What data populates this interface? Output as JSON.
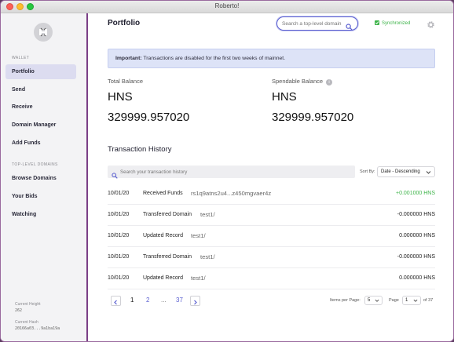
{
  "window": {
    "title": "Roberto!"
  },
  "sidebar": {
    "wallet_section": "WALLET",
    "wallet_items": [
      {
        "label": "Portfolio",
        "active": true
      },
      {
        "label": "Send"
      },
      {
        "label": "Receive"
      },
      {
        "label": "Domain Manager"
      },
      {
        "label": "Add Funds"
      }
    ],
    "domains_section": "TOP-LEVEL DOMAINS",
    "domain_items": [
      {
        "label": "Browse Domains"
      },
      {
        "label": "Your Bids"
      },
      {
        "label": "Watching"
      }
    ],
    "current_height_label": "Current Height",
    "current_height": "262",
    "current_hash_label": "Current Hash",
    "current_hash": "20166a03...9a1ba19a"
  },
  "header": {
    "title": "Portfolio",
    "search_placeholder": "Search a top-level domain",
    "sync_status": "Synchronized"
  },
  "notice": {
    "bold": "Important:",
    "text": " Transactions are disabled for the first two weeks of mainnet."
  },
  "balances": {
    "total_label": "Total Balance",
    "total_unit": "HNS",
    "total_value": "329999.957020",
    "spendable_label": "Spendable Balance",
    "spendable_unit": "HNS",
    "spendable_value": "329999.957020"
  },
  "transactions": {
    "heading": "Transaction History",
    "search_placeholder": "Search your transaction history",
    "sort_label": "Sort By:",
    "sort_value": "Date - Descending",
    "rows": [
      {
        "date": "10/01/20",
        "type": "Received Funds",
        "detail": "rs1q9atns2u4...z450mgvaer4z",
        "amount": "+0.001000 HNS",
        "positive": true
      },
      {
        "date": "10/01/20",
        "type": "Transferred Domain",
        "detail": "test1/",
        "amount": "-0.000000 HNS",
        "positive": false
      },
      {
        "date": "10/01/20",
        "type": "Updated Record",
        "detail": "test1/",
        "amount": "0.000000 HNS",
        "positive": false
      },
      {
        "date": "10/01/20",
        "type": "Transferred Domain",
        "detail": "test1/",
        "amount": "-0.000000 HNS",
        "positive": false
      },
      {
        "date": "10/01/20",
        "type": "Updated Record",
        "detail": "test1/",
        "amount": "0.000000 HNS",
        "positive": false
      }
    ]
  },
  "pagination": {
    "current": "1",
    "next": "2",
    "ellipsis": "...",
    "last": "37",
    "items_per_page_label": "Items per Page:",
    "items_per_page": "5",
    "page_label": "Page",
    "page_value": "1",
    "of_label": "of 37"
  },
  "colors": {
    "accent": "#5a5fd0",
    "positive": "#3eb44a",
    "sidebar_border": "#7b3f86",
    "notice_bg": "#dde3f7"
  },
  "icons": {
    "logo": "handshake-logo",
    "search": "search-icon",
    "sync": "check-icon",
    "settings": "gear-icon",
    "info": "info-icon",
    "prev": "chevron-left-icon",
    "next": "chevron-right-icon",
    "dropdown": "chevron-down-icon"
  }
}
